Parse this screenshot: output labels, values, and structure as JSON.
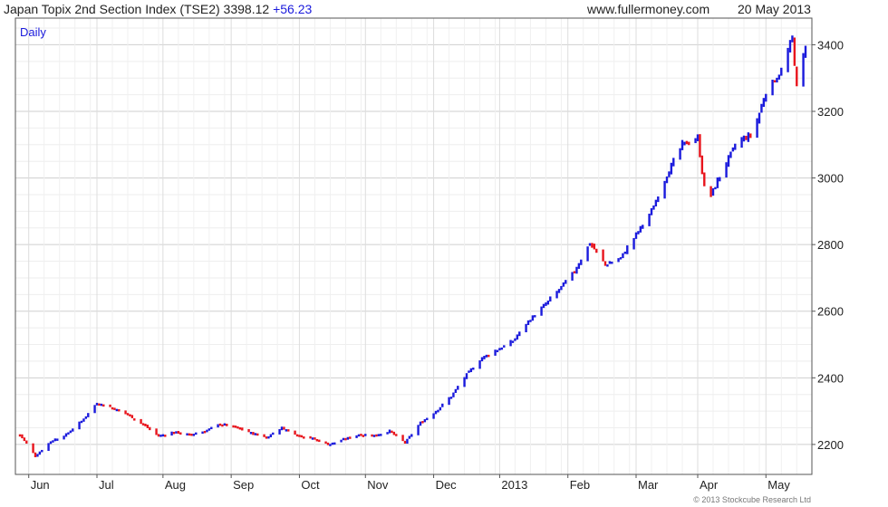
{
  "header": {
    "title": "Japan Topix 2nd Section Index (TSE2) 3398.12",
    "change": "+56.23",
    "site": "www.fullermoney.com",
    "date": "20 May 2013"
  },
  "colors": {
    "up": "#1a1adc",
    "down": "#e8141c",
    "grid": "#dddddd",
    "frame": "#555555"
  },
  "chart_data": {
    "type": "line",
    "title": "Japan Topix 2nd Section Index (TSE2) 3398.12 +56.23",
    "period_label": "Daily",
    "y_range": [
      2110,
      3480
    ],
    "y_ticks": [
      "2200",
      "2400",
      "2600",
      "2800",
      "3000",
      "3200",
      "3400"
    ],
    "x_ticks": [
      "Jun",
      "Jul",
      "Aug",
      "Sep",
      "Oct",
      "Nov",
      "Dec",
      "2013",
      "Feb",
      "Mar",
      "Apr",
      "May"
    ],
    "grid": true,
    "copyright": "© 2013 Stockcube Research Ltd",
    "series": [
      {
        "style": "daily bars, blue = up day, red = down day",
        "points": [
          [
            "May 28",
            2230
          ],
          [
            "Jun 4",
            2165
          ],
          [
            "Jun 11",
            2210
          ],
          [
            "Jun 18",
            2230
          ],
          [
            "Jun 25",
            2270
          ],
          [
            "Jul 2",
            2325
          ],
          [
            "Jul 9",
            2310
          ],
          [
            "Jul 16",
            2290
          ],
          [
            "Jul 23",
            2260
          ],
          [
            "Jul 30",
            2225
          ],
          [
            "Aug 6",
            2238
          ],
          [
            "Aug 13",
            2230
          ],
          [
            "Aug 20",
            2240
          ],
          [
            "Aug 27",
            2262
          ],
          [
            "Sep 3",
            2252
          ],
          [
            "Sep 10",
            2235
          ],
          [
            "Sep 17",
            2222
          ],
          [
            "Sep 24",
            2250
          ],
          [
            "Oct 1",
            2230
          ],
          [
            "Oct 8",
            2218
          ],
          [
            "Oct 15",
            2200
          ],
          [
            "Oct 22",
            2215
          ],
          [
            "Oct 29",
            2230
          ],
          [
            "Nov 5",
            2228
          ],
          [
            "Nov 12",
            2240
          ],
          [
            "Nov 19",
            2205
          ],
          [
            "Nov 26",
            2265
          ],
          [
            "Dec 3",
            2300
          ],
          [
            "Dec 10",
            2345
          ],
          [
            "Dec 17",
            2410
          ],
          [
            "Dec 24",
            2460
          ],
          [
            "Jan 7",
            2510
          ],
          [
            "Jan 14",
            2570
          ],
          [
            "Jan 21",
            2615
          ],
          [
            "Jan 28",
            2665
          ],
          [
            "Feb 4",
            2720
          ],
          [
            "Feb 11",
            2805
          ],
          [
            "Feb 18",
            2740
          ],
          [
            "Feb 25",
            2760
          ],
          [
            "Mar 4",
            2830
          ],
          [
            "Mar 11",
            2900
          ],
          [
            "Mar 18",
            3010
          ],
          [
            "Mar 25",
            3100
          ],
          [
            "Apr 1",
            3120
          ],
          [
            "Apr 5",
            2920
          ],
          [
            "Apr 12",
            3020
          ],
          [
            "Apr 19",
            3110
          ],
          [
            "Apr 26",
            3130
          ],
          [
            "May 2",
            3260
          ],
          [
            "May 9",
            3320
          ],
          [
            "May 14",
            3420
          ],
          [
            "May 16",
            3270
          ],
          [
            "May 20",
            3398
          ]
        ]
      }
    ]
  }
}
